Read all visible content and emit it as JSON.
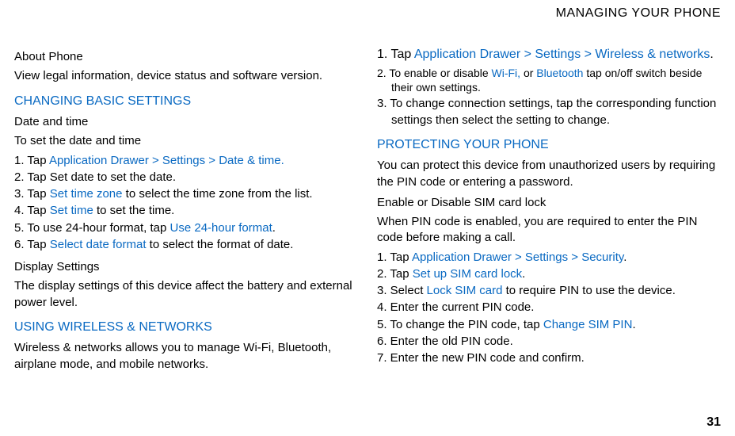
{
  "header": "MANAGING YOUR PHONE",
  "page_number": "31",
  "left": {
    "about_phone_title": "About Phone",
    "about_phone_body": "View legal information, device status and software version.",
    "changing_basic": "CHANGING BASIC SETTINGS",
    "date_time_title": "Date and time",
    "date_time_sub": "To set the date and time",
    "dt1_a": "1. Tap ",
    "dt1_link": "Application Drawer > Settings > Date & time.",
    "dt2": "2. Tap Set date to set the date.",
    "dt3_a": "3. Tap ",
    "dt3_link": "Set time zone",
    "dt3_b": " to select the time zone from the list.",
    "dt4_a": "4. Tap ",
    "dt4_link": "Set time",
    "dt4_b": " to set the time.",
    "dt5_a": "5. To use 24-hour format, tap ",
    "dt5_link": "Use 24-hour format",
    "dt5_b": ".",
    "dt6_a": "6. Tap ",
    "dt6_link": "Select date format",
    "dt6_b": " to select the format of date.",
    "display_title": "Display Settings",
    "display_body": "The display settings of this device affect the battery and external power level.",
    "wireless_heading": "USING WIRELESS & NETWORKS",
    "wireless_body": "Wireless & networks allows you to manage Wi-Fi, Bluetooth, airplane mode, and mobile networks."
  },
  "right": {
    "wn1_a": "1. Tap ",
    "wn1_link": "Application Drawer > Settings > Wireless & networks",
    "wn1_b": ".",
    "wn2_a": "2. To enable or disable ",
    "wn2_link1": "Wi-Fi,",
    "wn2_mid": " or ",
    "wn2_link2": "Bluetooth",
    "wn2_b": " tap on/off switch beside their own settings.",
    "wn3": "3. To change connection settings, tap the corresponding function settings then select the setting to change.",
    "protect_heading": "PROTECTING YOUR PHONE",
    "protect_body": "You can protect this device from unauthorized users by requiring the PIN code or entering a password.",
    "sim_title": "Enable or Disable SIM card lock",
    "sim_body": "When PIN code is enabled, you are required to enter the PIN code before making a call.",
    "s1_a": "1. Tap ",
    "s1_link": "Application Drawer > Settings > Security",
    "s1_b": ".",
    "s2_a": "2. Tap ",
    "s2_link": "Set up SIM card lock",
    "s2_b": ".",
    "s3_a": "3. Select ",
    "s3_link": "Lock SIM card",
    "s3_b": " to require PIN to use the device.",
    "s4": "4. Enter the current PIN code.",
    "s5_a": "5. To change the PIN code, tap ",
    "s5_link": "Change SIM PIN",
    "s5_b": ".",
    "s6": "6. Enter the old PIN code.",
    "s7": "7. Enter the new PIN code and confirm."
  }
}
